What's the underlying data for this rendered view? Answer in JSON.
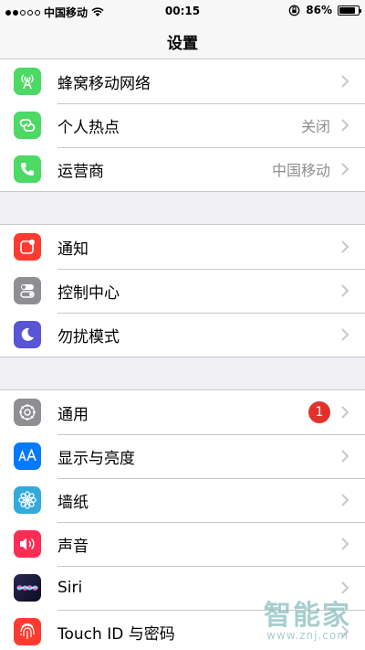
{
  "status_bar": {
    "carrier": "中国移动",
    "time": "00:15",
    "battery_percent": "86%",
    "battery_level": 0.86,
    "signal_dots_filled": 2,
    "signal_dots_total": 5,
    "icons": [
      "wifi-icon",
      "rotation-lock-icon",
      "battery-icon"
    ]
  },
  "nav": {
    "title": "设置"
  },
  "groups": [
    {
      "rows": [
        {
          "label": "蜂窝移动网络",
          "value": "",
          "icon": "cellular-icon",
          "color": "#4cd964"
        },
        {
          "label": "个人热点",
          "value": "关闭",
          "icon": "hotspot-icon",
          "color": "#4cd964"
        },
        {
          "label": "运营商",
          "value": "中国移动",
          "icon": "phone-icon",
          "color": "#4cd964"
        }
      ]
    },
    {
      "rows": [
        {
          "label": "通知",
          "value": "",
          "icon": "notifications-icon",
          "color": "#ff3b30"
        },
        {
          "label": "控制中心",
          "value": "",
          "icon": "control-center-icon",
          "color": "#8e8e93"
        },
        {
          "label": "勿扰模式",
          "value": "",
          "icon": "moon-icon",
          "color": "#5856d6"
        }
      ]
    },
    {
      "rows": [
        {
          "label": "通用",
          "badge": "1",
          "icon": "gear-icon",
          "color": "#8e8e93"
        },
        {
          "label": "显示与亮度",
          "value": "",
          "icon": "display-icon",
          "color": "#007aff"
        },
        {
          "label": "墙纸",
          "value": "",
          "icon": "wallpaper-icon",
          "color": "#34aadc"
        },
        {
          "label": "声音",
          "value": "",
          "icon": "sound-icon",
          "color": "#ff2d55"
        },
        {
          "label": "Siri",
          "value": "",
          "icon": "siri-icon",
          "color": "#1c1c3a"
        },
        {
          "label": "Touch ID 与密码",
          "value": "",
          "icon": "fingerprint-icon",
          "color": "#ff3b30"
        }
      ]
    }
  ],
  "watermark": {
    "brand": "智能家",
    "url": "www.znj.com"
  }
}
